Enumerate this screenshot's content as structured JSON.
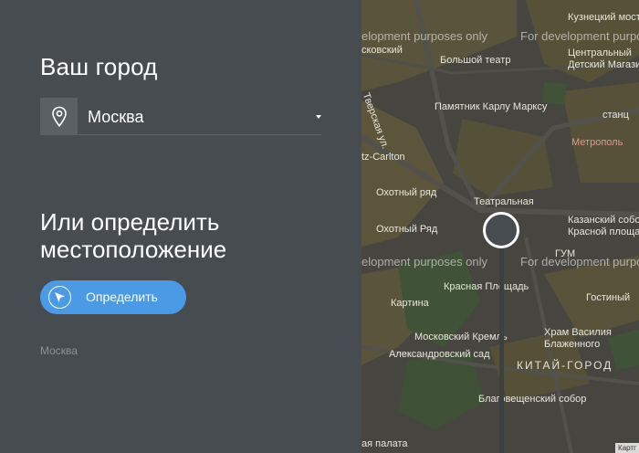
{
  "city_section": {
    "title": "Ваш город",
    "selected_city": "Москва"
  },
  "locate_section": {
    "title": "Или определить местоположение",
    "button_label": "Определить",
    "detected_city": "Москва"
  },
  "map": {
    "watermark": "For development purposes only",
    "watermark_left": "elopment purposes only",
    "credit": "Картг",
    "labels": {
      "kuznetsky": "Кузнецкий мост",
      "moskovsky": "сковский",
      "bolshoy": "Большой театр",
      "detsky1": "Центральный",
      "detsky2": "Детский Магазин",
      "magazine": "Магазин",
      "tverskaya": "Тверская ул.",
      "marx": "Памятник Карлу Марксу",
      "stantsia": "станц",
      "metropol": "Метрополь",
      "carlton": "tz-Carlton",
      "okhotny1": "Охотный ряд",
      "teatralnaya": "Театральная",
      "kazansky1": "Казанский собор",
      "kazansky2": "Красной площади",
      "okhotny2": "Охотный Ряд",
      "gum": "ГУМ",
      "krasnaya": "Красная Площадь",
      "gostiny": "Гостиный",
      "kartina": "Картина",
      "vasily1": "Храм Василия",
      "vasily2": "Блаженного",
      "kreml": "Московский Кремль",
      "aleks": "Александровский сад",
      "kitai": "КИТАЙ-ГОРОД",
      "blago": "Благовещенский собор",
      "palata": "ая палата"
    }
  },
  "colors": {
    "panel_bg": "#474c51",
    "button_bg": "#4a9ae6",
    "secondary_text": "#8d9297"
  }
}
